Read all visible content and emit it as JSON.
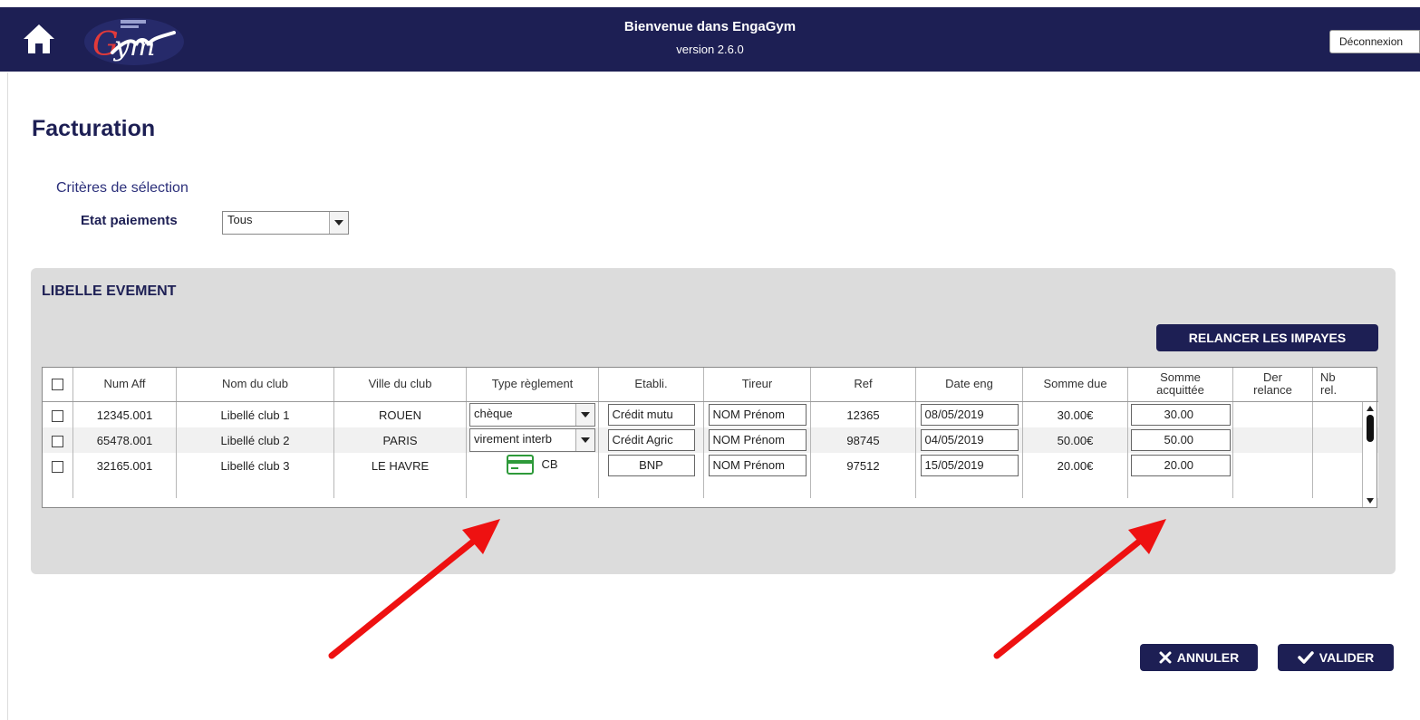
{
  "header": {
    "title": "Bienvenue dans EngaGym",
    "version": "version 2.6.0",
    "logout_label": "Déconnexion",
    "home_icon": "home-icon",
    "logo_text": "Gym",
    "bg_color": "#1d1f54"
  },
  "page": {
    "title": "Facturation",
    "criteria_title": "Critères de sélection",
    "etat_label": "Etat paiements",
    "etat_value": "Tous"
  },
  "panel": {
    "title": "LIBELLE EVEMENT",
    "relancer_label": "RELANCER LES IMPAYES"
  },
  "table": {
    "headers": {
      "num_aff": "Num Aff",
      "nom_club": "Nom du club",
      "ville_club": "Ville du club",
      "type_reglement": "Type règlement",
      "etabli": "Etabli.",
      "tireur": "Tireur",
      "ref": "Ref",
      "date_eng": "Date eng",
      "somme_due": "Somme due",
      "somme_acquittee_1": "Somme",
      "somme_acquittee_2": "acquittée",
      "der_relance_1": "Der",
      "der_relance_2": "relance",
      "nb_rel_1": "Nb",
      "nb_rel_2": "rel."
    },
    "rows": [
      {
        "num_aff": "12345.001",
        "nom_club": "Libellé club 1",
        "ville": "ROUEN",
        "type_reglement": "chèque",
        "etabli": "Crédit mutu",
        "tireur": "NOM Prénom",
        "ref": "12365",
        "date_eng": "08/05/2019",
        "somme_due": "30.00€",
        "somme_acquittee": "30.00"
      },
      {
        "num_aff": "65478.001",
        "nom_club": "Libellé club 2",
        "ville": "PARIS",
        "type_reglement": "virement interb",
        "etabli": "Crédit Agric",
        "tireur": "NOM Prénom",
        "ref": "98745",
        "date_eng": "04/05/2019",
        "somme_due": "50.00€",
        "somme_acquittee": "50.00"
      },
      {
        "num_aff": "32165.001",
        "nom_club": "Libellé club 3",
        "ville": "LE HAVRE",
        "type_reglement": "CB",
        "etabli": "BNP",
        "tireur": "NOM Prénom",
        "ref": "97512",
        "date_eng": "15/05/2019",
        "somme_due": "20.00€",
        "somme_acquittee": "20.00"
      }
    ]
  },
  "buttons": {
    "annuler_label": "ANNULER",
    "valider_label": "VALIDER"
  },
  "colors": {
    "accent": "#1d1f54",
    "due_green": "#2e9a3a",
    "annotation_red": "#ee1111"
  }
}
